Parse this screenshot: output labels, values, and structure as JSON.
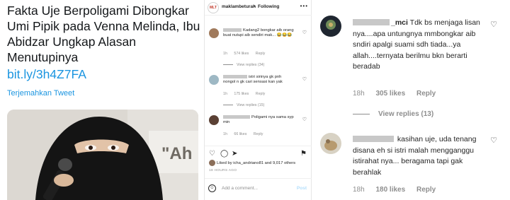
{
  "tweet": {
    "text": "Fakta Uje Berpoligami Dibongkar Umi Pipik pada Venna Melinda, Ibu Abidzar Ungkap Alasan Menutupinya",
    "link": "bit.ly/3h4Z7FA",
    "translate": "Terjemahkan Tweet",
    "media_watermark": "\"Ah"
  },
  "ig": {
    "avatar_text": "MLT",
    "username": "maklambeturah",
    "dot": "•",
    "follow": "Following",
    "more": "•••",
    "comments": [
      {
        "text": "Kadang2 bongkar aib orang buat nutupi aib sendiri mak... 😂😂😂",
        "time": "1h",
        "likes": "574 likes",
        "reply": "Reply",
        "view_replies": "View replies (34)"
      },
      {
        "text": "istri sirinya gk pnh nongol n gk cari sensasi kan yak",
        "time": "1h",
        "likes": "175 likes",
        "reply": "Reply",
        "view_replies": "View replies (15)"
      },
      {
        "text": "Poligami nya sama syp min",
        "time": "1h",
        "likes": "66 likes",
        "reply": "Reply",
        "view_replies": ""
      }
    ],
    "liked_by": "Liked by icha_andriano81 and 9,017 others",
    "timestamp": "18 HOURS AGO",
    "add_comment_placeholder": "Add a comment...",
    "post_label": "Post"
  },
  "right_comments": [
    {
      "name_tail": "_mci",
      "text": "Tdk bs menjaga lisan nya....apa untungnya mmbongkar aib sndiri apalgi suami sdh tiada...ya allah....ternyata berilmu bkn berarti beradab",
      "time": "18h",
      "likes": "305 likes",
      "reply": "Reply",
      "view_replies": "View replies (13)"
    },
    {
      "name_tail": "",
      "text": "kasihan uje, uda tenang disana eh si istri malah mengganggu istirahat nya... beragama tapi gak berahlak",
      "time": "18h",
      "likes": "180 likes",
      "reply": "Reply",
      "view_replies": ""
    }
  ],
  "icons": {
    "heart": "heart-icon",
    "comment": "comment-icon",
    "share": "share-icon",
    "bookmark": "bookmark-icon",
    "emoji": "emoji-icon"
  }
}
